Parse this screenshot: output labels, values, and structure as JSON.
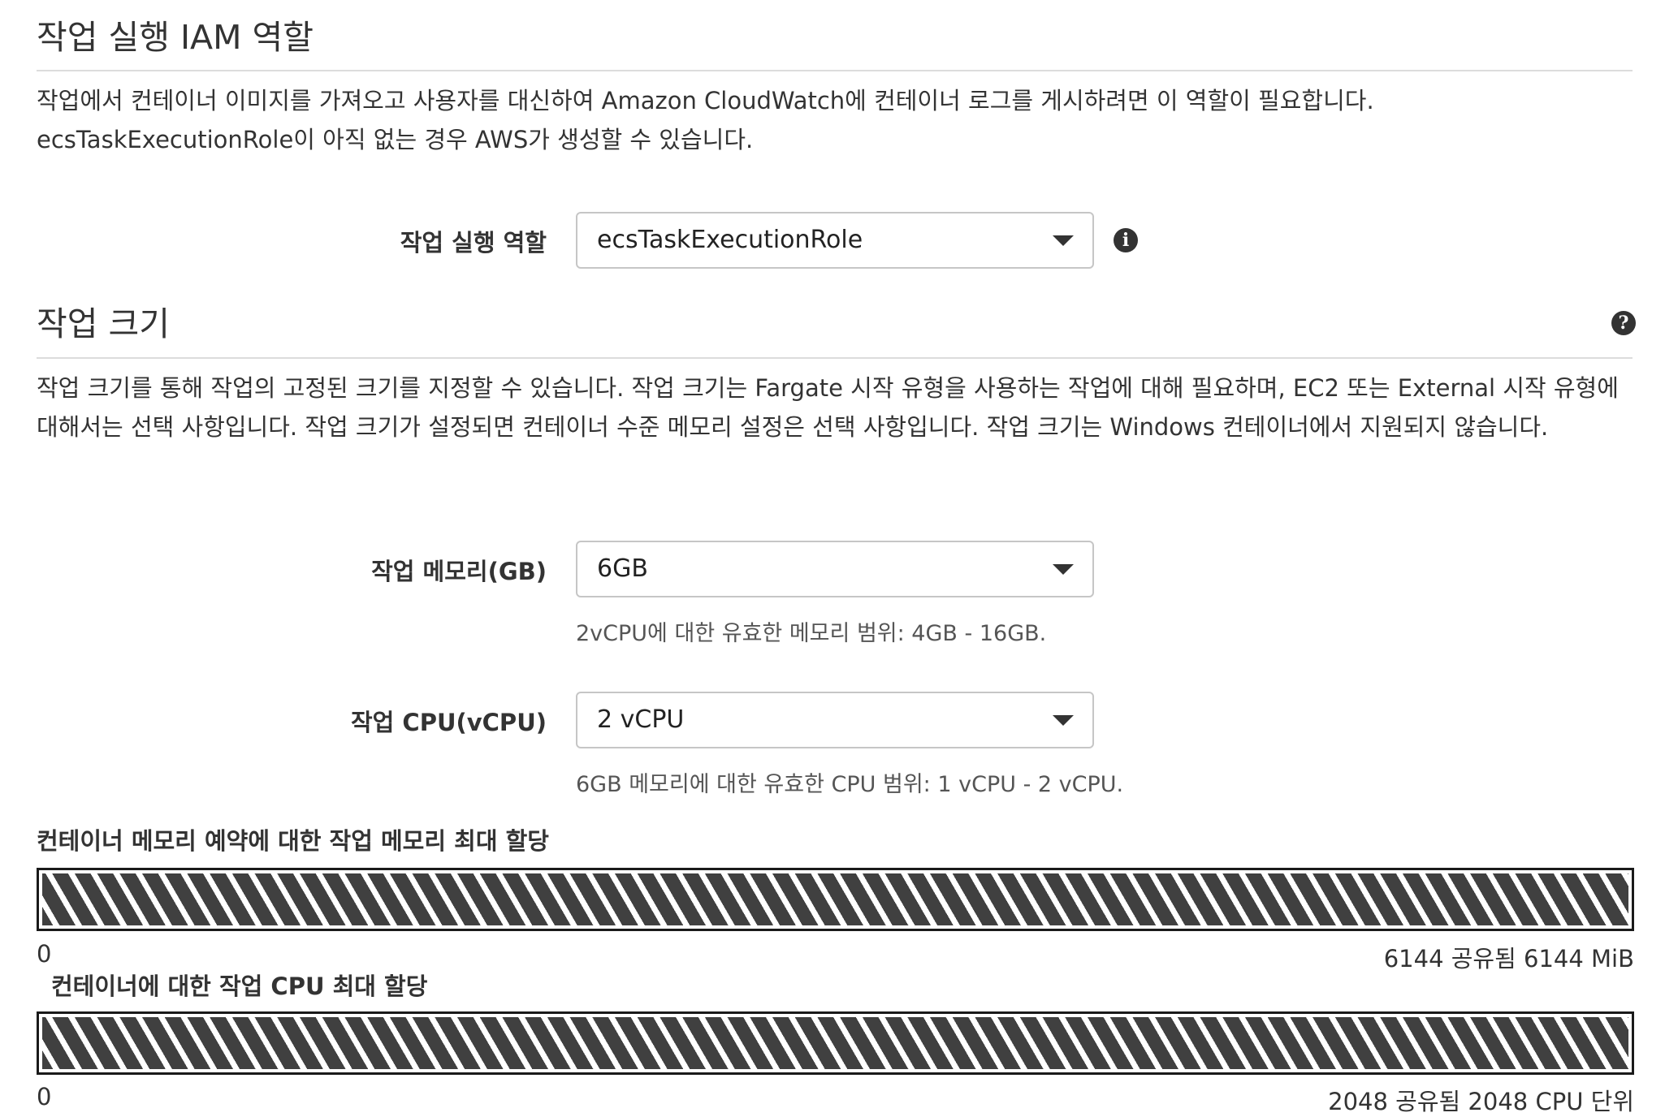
{
  "iam_section": {
    "title": "작업 실행 IAM 역할",
    "description_line1": "작업에서 컨테이너 이미지를 가져오고 사용자를 대신하여 Amazon CloudWatch에 컨테이너 로그를 게시하려면 이 역할이 필요합니다.",
    "description_line2": "ecsTaskExecutionRole이 아직 없는 경우 AWS가 생성할 수 있습니다.",
    "role_label": "작업 실행 역할",
    "role_value": "ecsTaskExecutionRole",
    "info_icon": "info-icon"
  },
  "task_size_section": {
    "title": "작업 크기",
    "help_icon": "question-icon",
    "description": "작업 크기를 통해 작업의 고정된 크기를 지정할 수 있습니다. 작업 크기는 Fargate 시작 유형을 사용하는 작업에 대해 필요하며, EC2 또는 External 시작 유형에 대해서는 선택 사항입니다. 작업 크기가 설정되면 컨테이너 수준 메모리 설정은 선택 사항입니다. 작업 크기는 Windows 컨테이너에서 지원되지 않습니다.",
    "memory_label": "작업 메모리(GB)",
    "memory_value": "6GB",
    "memory_hint": "2vCPU에 대한 유효한 메모리 범위: 4GB - 16GB.",
    "cpu_label": "작업 CPU(vCPU)",
    "cpu_value": "2 vCPU",
    "cpu_hint": "6GB 메모리에 대한 유효한 CPU 범위: 1 vCPU - 2 vCPU."
  },
  "memory_allocation": {
    "title": "컨테이너 메모리 예약에 대한 작업 메모리 최대 할당",
    "min_label": "0",
    "max_label": "6144 공유됨 6144 MiB"
  },
  "cpu_allocation": {
    "title": "컨테이너에 대한 작업 CPU 최대 할당",
    "min_label": "0",
    "max_label": "2048 공유됨 2048 CPU 단위"
  },
  "colors": {
    "bar_stripe": "#404040",
    "bar_border": "#1a1a1a",
    "divider": "#dcdcdc"
  }
}
